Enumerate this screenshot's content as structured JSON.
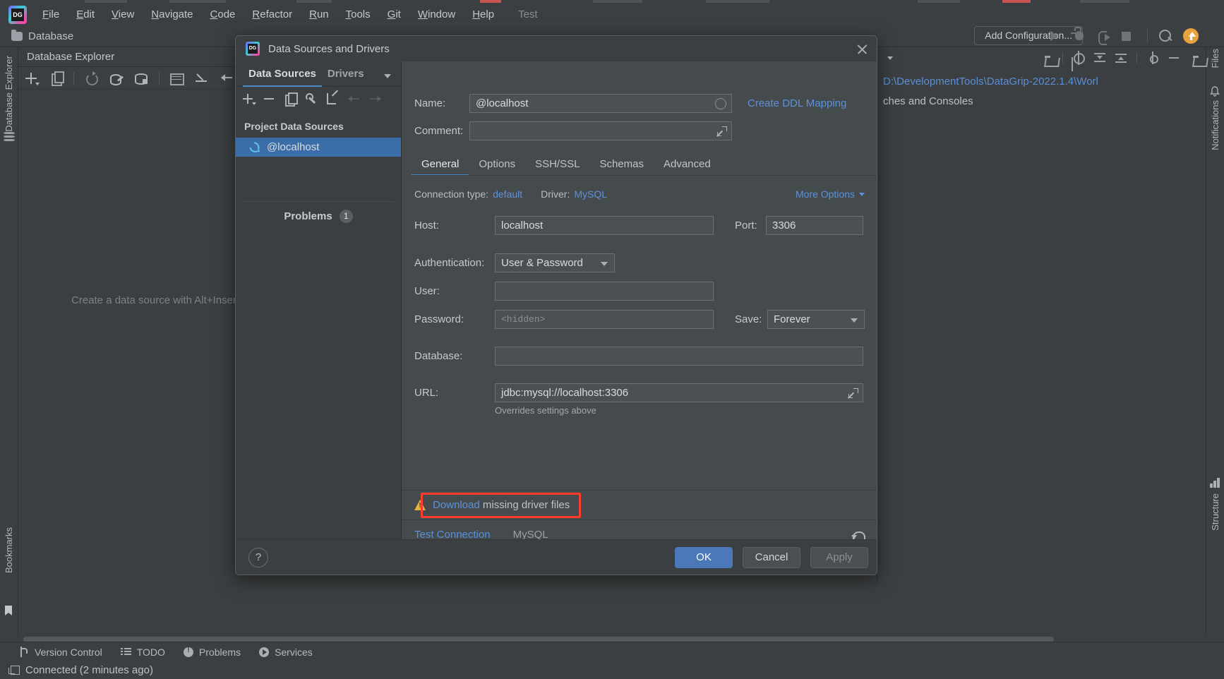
{
  "app": {
    "logo_icon": "datagrip-logo-icon",
    "project_name": "Test"
  },
  "menubar": {
    "items": [
      {
        "label": "File",
        "mnemonic": "F"
      },
      {
        "label": "Edit",
        "mnemonic": "E"
      },
      {
        "label": "View",
        "mnemonic": "V"
      },
      {
        "label": "Navigate",
        "mnemonic": "N"
      },
      {
        "label": "Code",
        "mnemonic": "C"
      },
      {
        "label": "Refactor",
        "mnemonic": "R"
      },
      {
        "label": "Run",
        "mnemonic": "R"
      },
      {
        "label": "Tools",
        "mnemonic": "T"
      },
      {
        "label": "Git",
        "mnemonic": "G"
      },
      {
        "label": "Window",
        "mnemonic": "W"
      },
      {
        "label": "Help",
        "mnemonic": "H"
      }
    ]
  },
  "navbar": {
    "folder_icon": "folder-icon",
    "crumb": "Database",
    "add_configuration_label": "Add Configuration...",
    "run_icons": [
      "run-icon",
      "debug-icon",
      "attach-process-icon",
      "stop-icon",
      "search-everywhere-icon",
      "update-icon"
    ]
  },
  "rails": {
    "left_label": "Database Explorer",
    "left_bottom_icon": "database-icon",
    "right_top_label": "Notifications",
    "right_top_icon": "notifications-icon",
    "right_bottom_label": "Structure",
    "right_bottom_icon": "structure-icon",
    "bookmarks_label": "Bookmarks",
    "bookmarks_icon": "bookmark-icon",
    "files_label": "Files"
  },
  "database_explorer": {
    "title": "Database Explorer",
    "header_icons": [
      "locate-icon",
      "collapse-all-icon",
      "settings-icon",
      "hide-icon"
    ],
    "toolbar_icons": [
      "add-icon",
      "duplicate-icon",
      "refresh-icon",
      "data-source-properties-icon",
      "new-data-source-icon",
      "jump-to-query-console-icon",
      "modify-object-icon",
      "import-data-icon",
      "query-language-icon",
      "filter-icon",
      "open-folder-icon"
    ],
    "empty_hint": "Create a data source with Alt+Insert"
  },
  "right_panel": {
    "path": "D:\\DevelopmentTools\\DataGrip-2022.1.4\\Worl",
    "subtitle": "ches and Consoles",
    "icons": [
      "open-folder-icon",
      "locate-icon",
      "expand-all-icon",
      "collapse-all-icon",
      "settings-icon",
      "hide-icon",
      "folder-icon"
    ]
  },
  "dialog": {
    "title": "Data Sources and Drivers",
    "logo_icon": "datagrip-logo-icon",
    "close_icon": "close-icon",
    "left": {
      "tabs": [
        {
          "label": "Data Sources",
          "active": true
        },
        {
          "label": "Drivers",
          "active": false
        }
      ],
      "tabs_overflow_icon": "chevron-down-icon",
      "toolbar_icons": [
        "add-icon",
        "remove-icon",
        "duplicate-icon",
        "driver-properties-icon",
        "share-icon",
        "move-up-icon",
        "move-down-icon"
      ],
      "group_label": "Project Data Sources",
      "nodes": [
        {
          "label": "@localhost",
          "icon": "mysql-dolphin-icon",
          "selected": true
        }
      ],
      "problems_label": "Problems",
      "problems_count": "1"
    },
    "name": {
      "label": "Name:",
      "value": "@localhost",
      "placeholder": "",
      "color_badge_icon": "color-circle-icon"
    },
    "comment": {
      "label": "Comment:",
      "value": "",
      "placeholder": "",
      "expand_icon": "expand-editor-icon"
    },
    "create_ddl_mapping_label": "Create DDL Mapping",
    "tabs": [
      {
        "label": "General",
        "active": true
      },
      {
        "label": "Options",
        "active": false
      },
      {
        "label": "SSH/SSL",
        "active": false
      },
      {
        "label": "Schemas",
        "active": false
      },
      {
        "label": "Advanced",
        "active": false
      }
    ],
    "meta": {
      "connection_type_label": "Connection type:",
      "connection_type_value": "default",
      "driver_label": "Driver:",
      "driver_value": "MySQL",
      "more_options_label": "More Options",
      "more_options_icon": "chevron-down-icon"
    },
    "host": {
      "label": "Host:",
      "value": "localhost"
    },
    "port": {
      "label": "Port:",
      "value": "3306"
    },
    "authentication": {
      "label": "Authentication:",
      "value": "User & Password",
      "caret_icon": "chevron-down-icon"
    },
    "user": {
      "label": "User:",
      "value": ""
    },
    "password": {
      "label": "Password:",
      "value": "",
      "placeholder": "<hidden>"
    },
    "save": {
      "label": "Save:",
      "value": "Forever",
      "caret_icon": "chevron-down-icon"
    },
    "database": {
      "label": "Database:",
      "value": ""
    },
    "url": {
      "label": "URL:",
      "value": "jdbc:mysql://localhost:3306",
      "hint": "Overrides settings above",
      "expand_icon": "expand-editor-icon"
    },
    "warning": {
      "icon": "warning-triangle-icon",
      "link_text": "Download",
      "rest_text": " missing driver files",
      "highlight_color": "#ff3b30"
    },
    "test_connection_label": "Test Connection",
    "test_driver_label": "MySQL",
    "revert_icon": "revert-icon",
    "footer": {
      "help_label": "?",
      "help_icon": "help-icon",
      "ok_label": "OK",
      "cancel_label": "Cancel",
      "apply_label": "Apply"
    }
  },
  "statusbar": {
    "items": [
      {
        "label": "Version Control",
        "icon": "version-control-icon"
      },
      {
        "label": "TODO",
        "icon": "todo-icon"
      },
      {
        "label": "Problems",
        "icon": "problems-icon"
      },
      {
        "label": "Services",
        "icon": "services-icon"
      }
    ]
  },
  "connection_status": {
    "icon": "console-icon",
    "text": "Connected (2 minutes ago)"
  },
  "colors": {
    "accent_blue": "#4a88c7",
    "link_blue": "#5b93dd",
    "selection_blue": "#3b6ea8",
    "warning_yellow": "#e8b23a",
    "highlight_red": "#ff3b30",
    "window_bg": "#3c3f41",
    "panel_bg": "#454a4d"
  }
}
